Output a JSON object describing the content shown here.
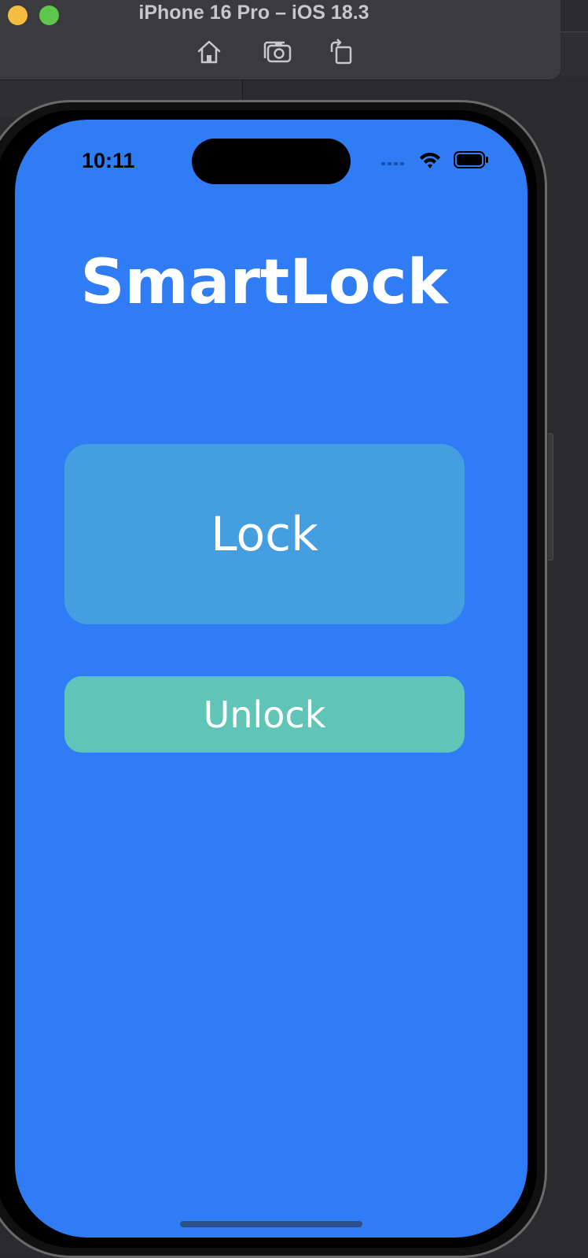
{
  "simulator": {
    "title": "iPhone 16 Pro – iOS 18.3",
    "toolbar_icons": [
      "home-icon",
      "screenshot-icon",
      "rotate-icon"
    ]
  },
  "status_bar": {
    "time": "10:11",
    "icons": [
      "cellular-icon",
      "wifi-icon",
      "battery-icon"
    ]
  },
  "app": {
    "title": "SmartLock",
    "lock_label": "Lock",
    "unlock_label": "Unlock"
  },
  "colors": {
    "background": "#307cf5",
    "lock_button": "#449edf",
    "unlock_button": "#60c5b6"
  }
}
